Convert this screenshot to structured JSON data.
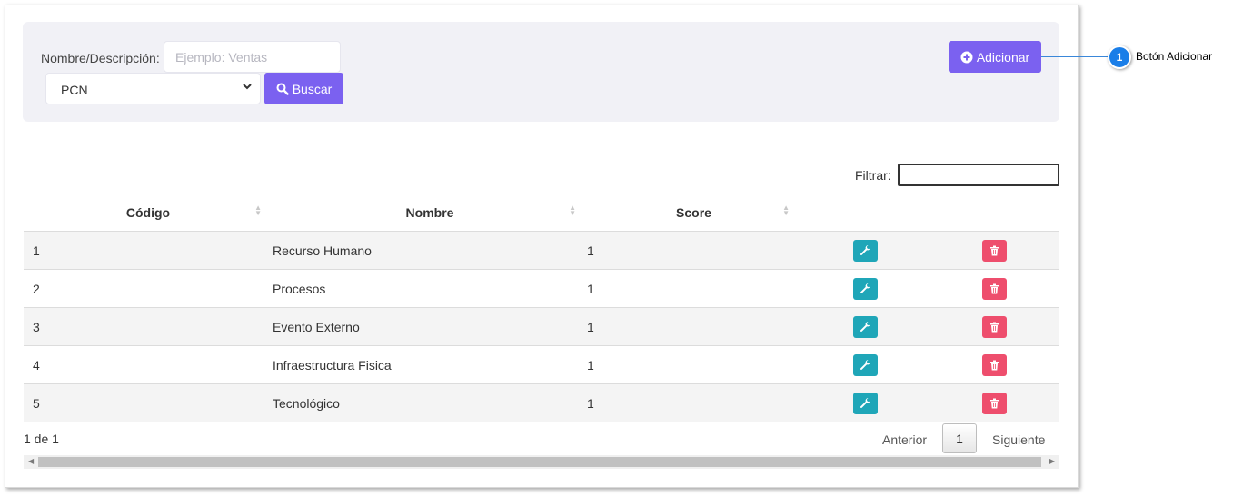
{
  "search": {
    "label": "Nombre/Descripción:",
    "placeholder": "Ejemplo: Ventas",
    "select_value": "PCN",
    "search_button": "Buscar",
    "add_button": "Adicionar"
  },
  "callout": {
    "number": "1",
    "text": "Botón Adicionar"
  },
  "filter": {
    "label": "Filtrar:"
  },
  "table": {
    "headers": [
      "Código",
      "Nombre",
      "Score"
    ],
    "rows": [
      {
        "codigo": "1",
        "nombre": "Recurso Humano",
        "score": "1"
      },
      {
        "codigo": "2",
        "nombre": "Procesos",
        "score": "1"
      },
      {
        "codigo": "3",
        "nombre": "Evento Externo",
        "score": "1"
      },
      {
        "codigo": "4",
        "nombre": "Infraestructura Fisica",
        "score": "1"
      },
      {
        "codigo": "5",
        "nombre": "Tecnológico",
        "score": "1"
      }
    ]
  },
  "pagination": {
    "info": "1 de 1",
    "prev": "Anterior",
    "current": "1",
    "next": "Siguiente"
  },
  "colors": {
    "accent": "#7b61f0",
    "edit": "#1fa6b8",
    "delete": "#ee4e6d",
    "callout": "#1a7ee8"
  }
}
